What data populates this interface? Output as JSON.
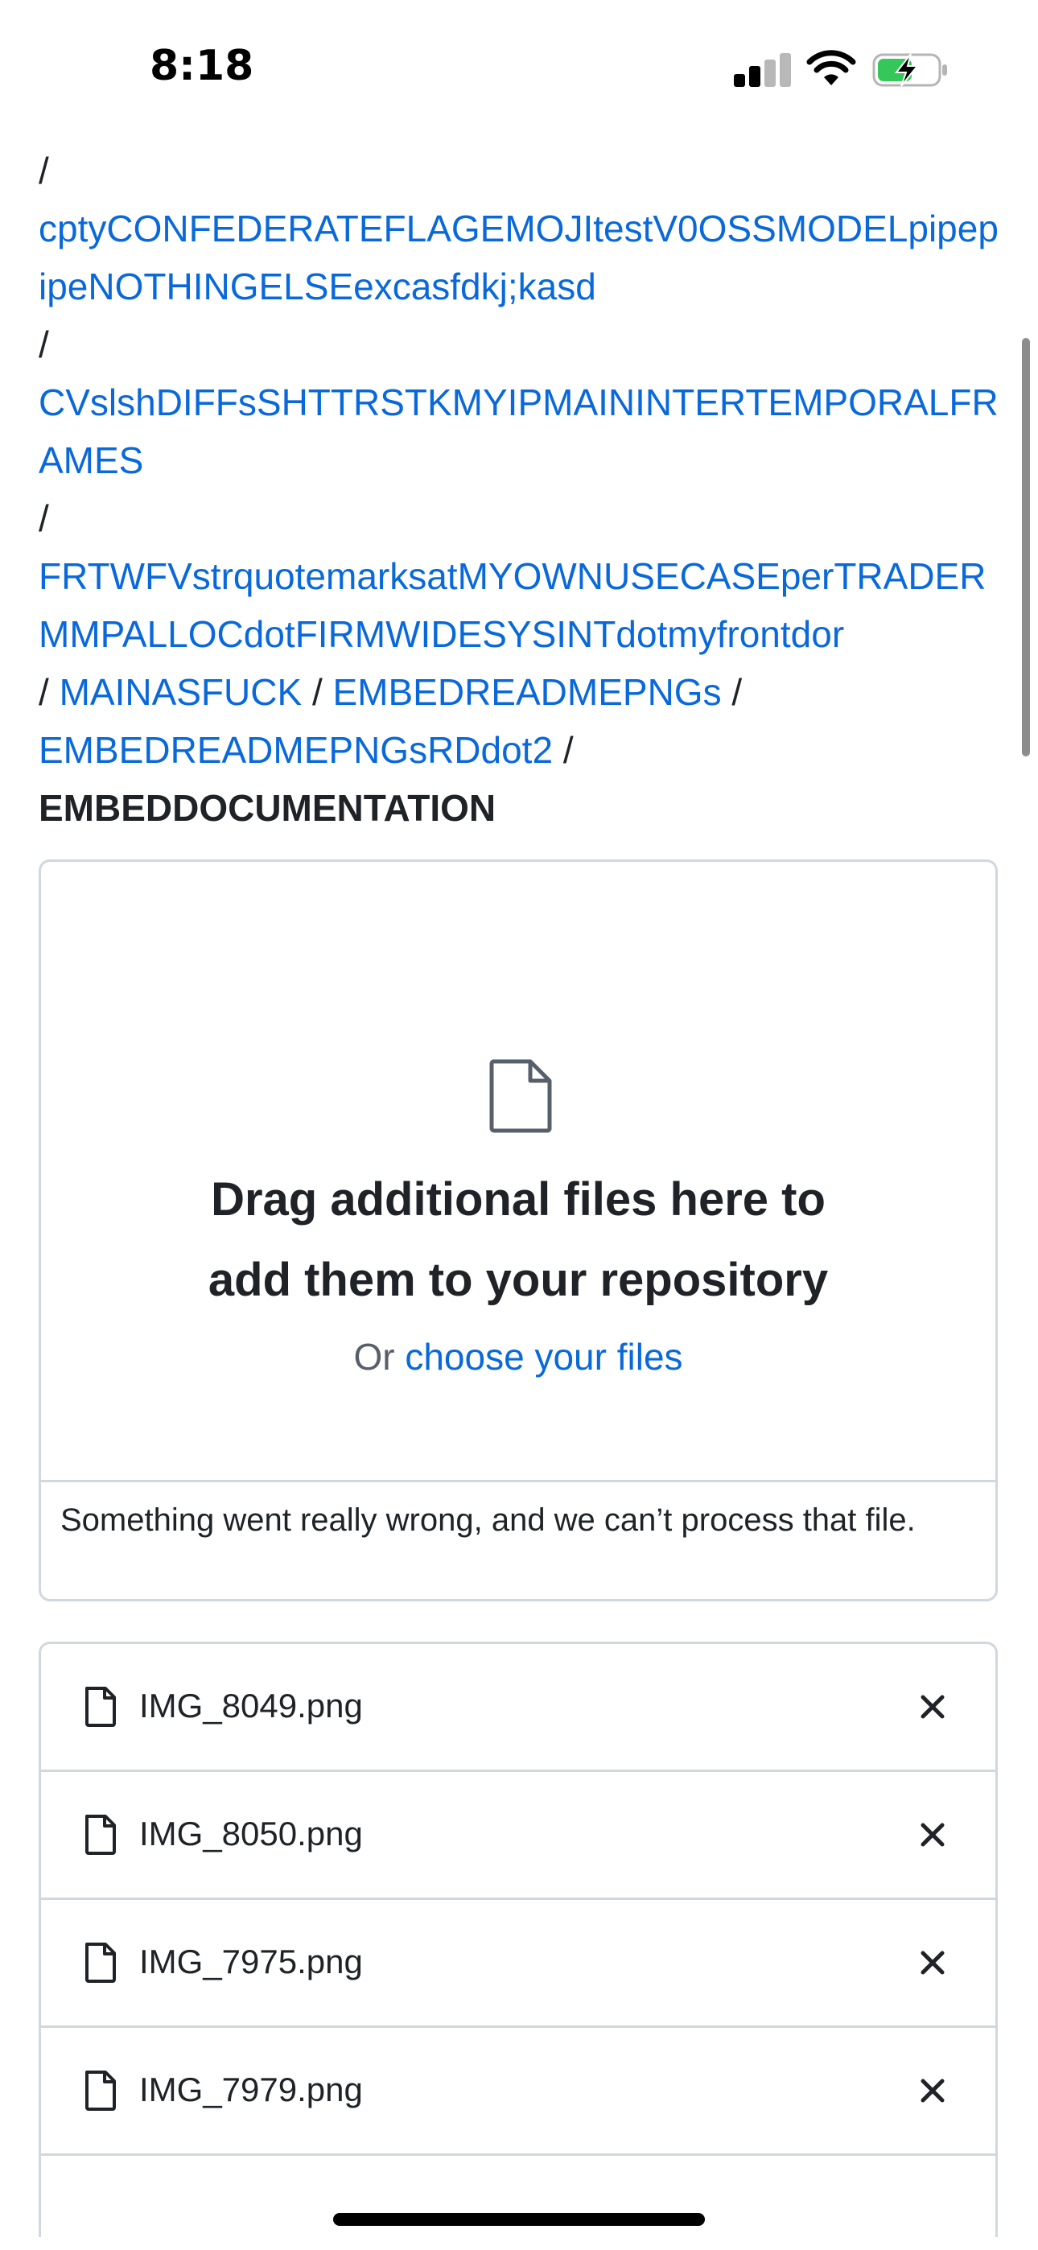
{
  "status_bar": {
    "time": "8:18"
  },
  "breadcrumb": {
    "items": [
      "cptyCONFEDERATEFLAGEMOJItestV0OSSMODELpipepipeNOTHINGELSEexcasfdkj;kasd",
      "CVslshDIFFsSHTTRSTKMYIPMAININTERTEMPORALFRAMES",
      "FRTWFVstrquotemarksatMYOWNUSECASEperTRADERMMPALLOCdotFIRMWIDESYSINTdotmyfrontdor",
      "MAINASFUCK",
      "EMBEDREADMEPNGs",
      "EMBEDREADMEPNGsRDdot2"
    ],
    "separator": "/",
    "current": "EMBEDDOCUMENTATION"
  },
  "dropzone": {
    "title_line1": "Drag additional files here to",
    "title_line2": "add them to your repository",
    "or_text": "Or ",
    "choose_link": "choose your files",
    "error_message": "Something went really wrong, and we can’t process that file."
  },
  "files": [
    {
      "name": "IMG_8049.png"
    },
    {
      "name": "IMG_8050.png"
    },
    {
      "name": "IMG_7975.png"
    },
    {
      "name": "IMG_7979.png"
    }
  ],
  "colors": {
    "link": "#0969da",
    "text": "#1f2328",
    "border": "#d0d7de",
    "muted": "#57606a",
    "battery_green": "#34c759"
  }
}
